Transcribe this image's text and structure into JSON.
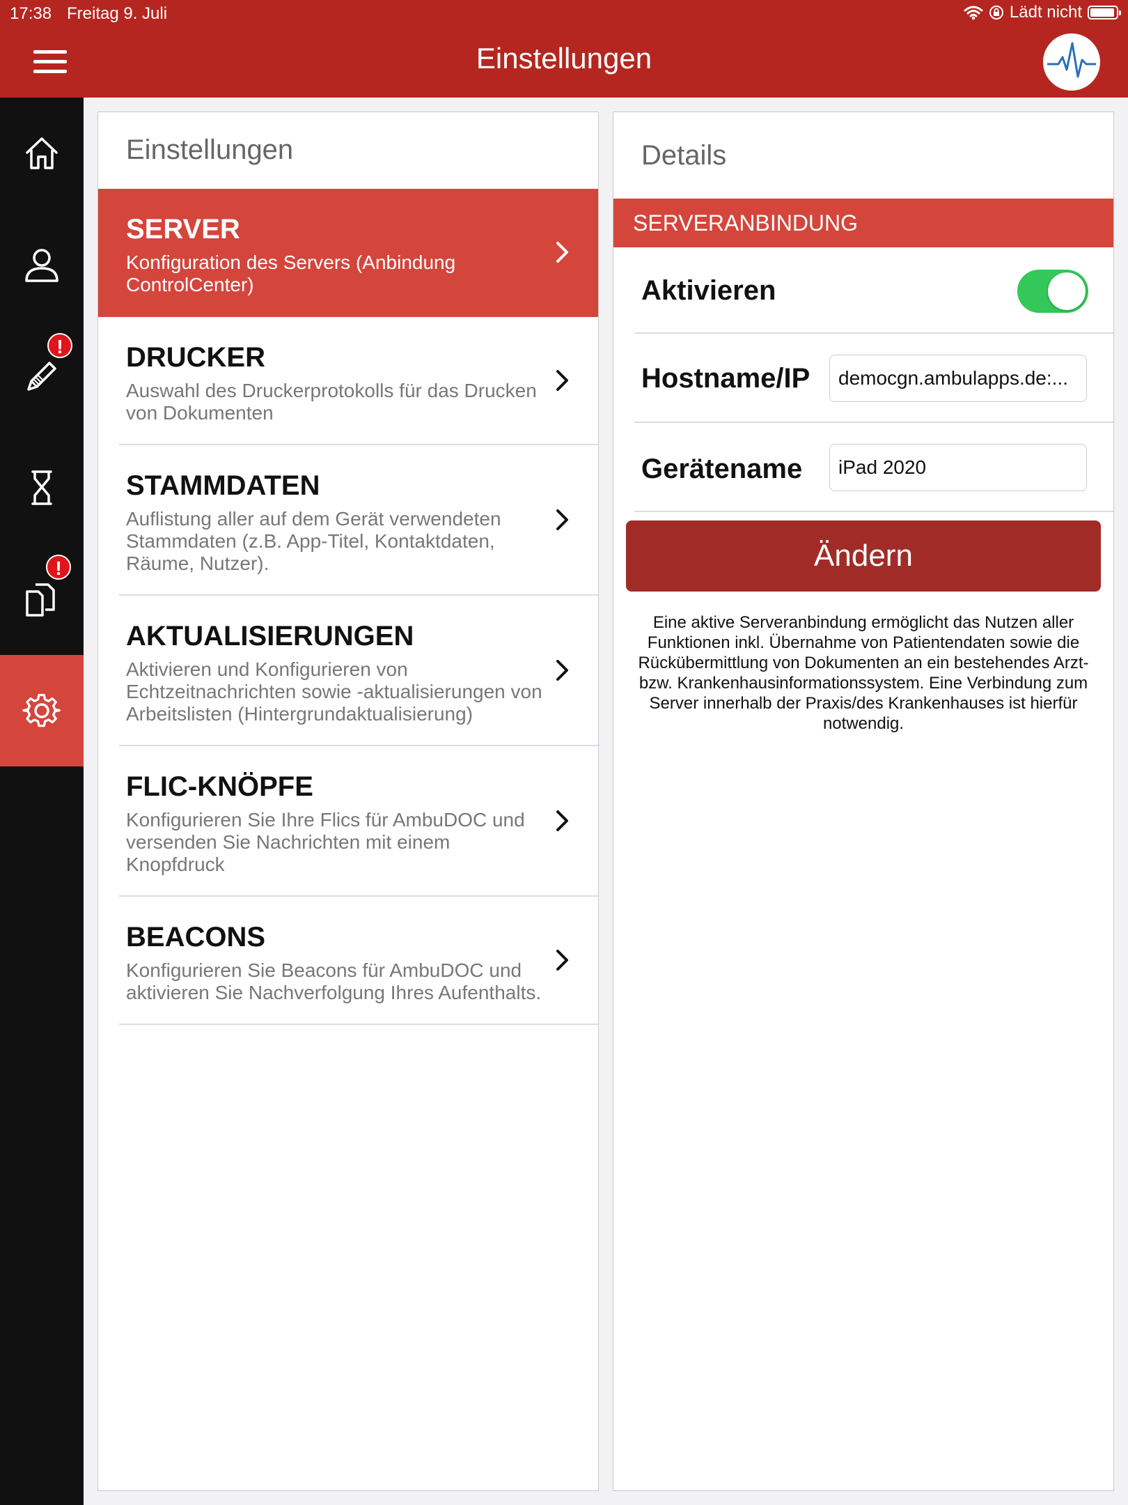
{
  "status_bar": {
    "time": "17:38",
    "date": "Freitag 9. Juli",
    "charging": "Lädt nicht"
  },
  "header": {
    "title": "Einstellungen"
  },
  "sidebar": {
    "items": [
      {
        "icon": "home-icon"
      },
      {
        "icon": "user-icon"
      },
      {
        "icon": "pencil-icon",
        "badge": "!"
      },
      {
        "icon": "hourglass-icon"
      },
      {
        "icon": "documents-icon",
        "badge": "!"
      },
      {
        "icon": "gear-icon",
        "active": true
      }
    ]
  },
  "settings": {
    "heading": "Einstellungen",
    "items": [
      {
        "title": "SERVER",
        "subtitle": "Konfiguration des Servers (Anbindung ControlCenter)"
      },
      {
        "title": "DRUCKER",
        "subtitle": "Auswahl des Druckerprotokolls für das Drucken von Dokumenten"
      },
      {
        "title": "STAMMDATEN",
        "subtitle": "Auflistung aller auf dem Gerät verwendeten Stammdaten (z.B. App-Titel, Kontaktdaten, Räume, Nutzer)."
      },
      {
        "title": "AKTUALISIERUNGEN",
        "subtitle": "Aktivieren und Konfigurieren von Echtzeitnachrichten sowie -aktualisierungen von Arbeitslisten (Hintergrundaktualisierung)"
      },
      {
        "title": "FLIC-KNÖPFE",
        "subtitle": "Konfigurieren Sie Ihre Flics für AmbuDOC und versenden Sie Nachrichten mit einem Knopfdruck"
      },
      {
        "title": "BEACONS",
        "subtitle": "Konfigurieren Sie Beacons für AmbuDOC und aktivieren Sie Nachverfolgung Ihres Aufenthalts."
      }
    ]
  },
  "details": {
    "heading": "Details",
    "section": "SERVERANBINDUNG",
    "activate_label": "Aktivieren",
    "activate_on": true,
    "hostname_label": "Hostname/IP",
    "hostname_value": "democgn.ambulapps.de:...",
    "device_label": "Gerätename",
    "device_value": "iPad 2020",
    "change_label": "Ändern",
    "info": "Eine aktive Serveranbindung ermöglicht das Nutzen aller Funktionen inkl. Übernahme von Patientendaten sowie die Rückübermittlung von Dokumenten an ein bestehendes Arzt- bzw. Krankenhausinformationssystem. Eine Verbindung zum Server innerhalb der Praxis/des Krankenhauses ist hierfür notwendig."
  }
}
